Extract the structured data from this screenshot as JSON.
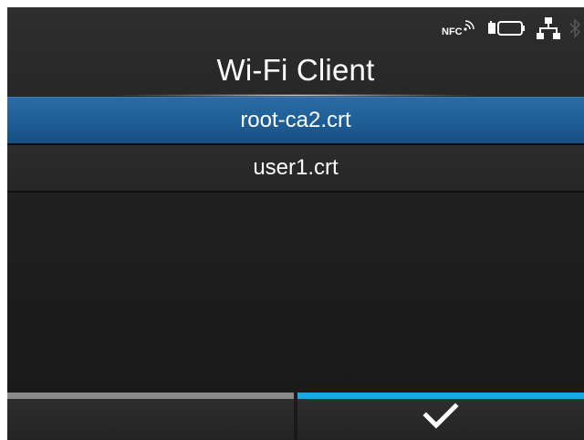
{
  "status_bar": {
    "nfc_label": "NFC",
    "icons": [
      "nfc-icon",
      "battery-icon",
      "network-icon",
      "bluetooth-icon"
    ]
  },
  "header": {
    "title": "Wi-Fi Client"
  },
  "list": {
    "items": [
      {
        "label": "root-ca2.crt",
        "selected": true
      },
      {
        "label": "user1.crt",
        "selected": false
      }
    ]
  },
  "bottom_bar": {
    "left_button_label": "",
    "right_button_icon": "checkmark-icon"
  },
  "colors": {
    "selection": "#1f5f98",
    "accent_blue": "#19a9e6",
    "accent_gray": "#8a8a8a",
    "background": "#1f1f1f"
  }
}
